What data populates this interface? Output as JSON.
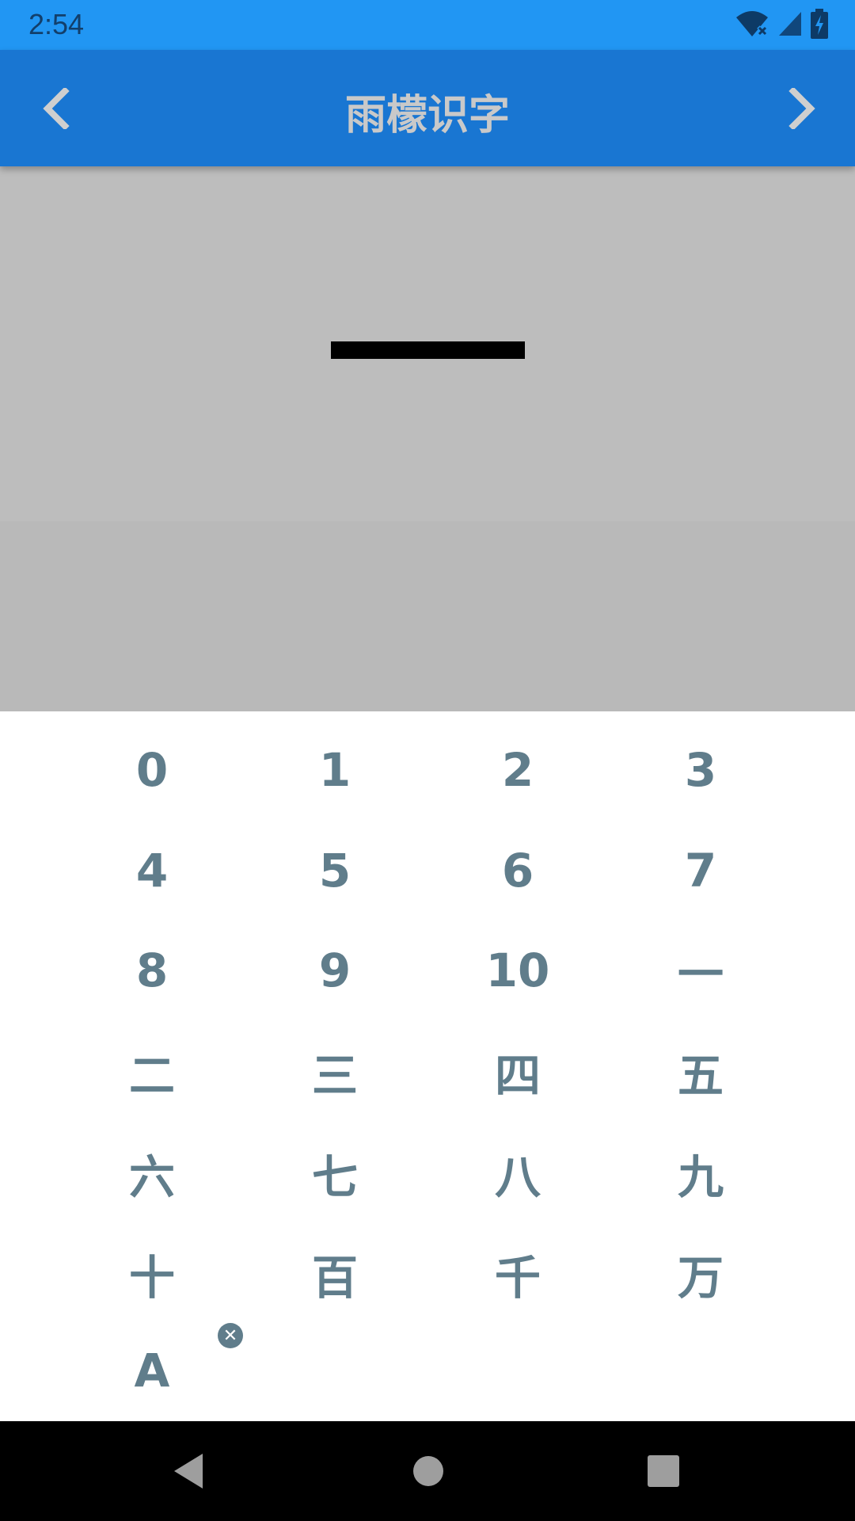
{
  "status_bar": {
    "time": "2:54",
    "icons": [
      "wifi-off-icon",
      "signal-icon",
      "battery-charging-icon"
    ]
  },
  "app_bar": {
    "title": "雨檬识字",
    "prev_icon": "chevron-left-icon",
    "next_icon": "chevron-right-icon"
  },
  "display": {
    "current_character": "一"
  },
  "keypad": {
    "keys": [
      "0",
      "1",
      "2",
      "3",
      "4",
      "5",
      "6",
      "7",
      "8",
      "9",
      "10",
      "一",
      "二",
      "三",
      "四",
      "五",
      "六",
      "七",
      "八",
      "九",
      "十",
      "百",
      "千",
      "万",
      "A"
    ],
    "clear_badge": "✕"
  },
  "system_nav": {
    "icons": [
      "back-icon",
      "home-icon",
      "recents-icon"
    ]
  },
  "colors": {
    "status_bar": "#2196F3",
    "app_bar": "#1976D2",
    "display_bg": "#BDBDBD",
    "key_text": "#607D8B"
  }
}
